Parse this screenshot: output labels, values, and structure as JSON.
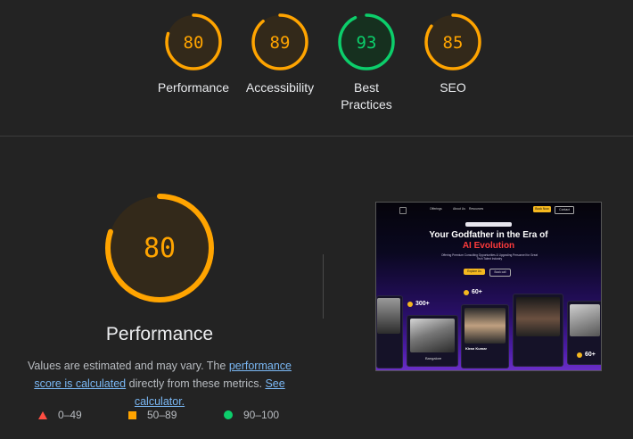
{
  "colors": {
    "orange": "#ffa400",
    "green": "#0cce6b",
    "red": "#ff4e42",
    "link": "#7ab8f5"
  },
  "scores": [
    {
      "label": "Performance",
      "value": 80,
      "rating": "average"
    },
    {
      "label": "Accessibility",
      "value": 89,
      "rating": "average"
    },
    {
      "label": "Best Practices",
      "value": 93,
      "rating": "pass"
    },
    {
      "label": "SEO",
      "value": 85,
      "rating": "average"
    }
  ],
  "main": {
    "title": "Performance",
    "score": 80,
    "note_prefix": "Values are estimated and may vary. The ",
    "note_link1": "performance score is calculated",
    "note_middle": " directly from these metrics. ",
    "note_link2": "See calculator."
  },
  "legend": [
    {
      "shape": "triangle",
      "range": "0–49"
    },
    {
      "shape": "square",
      "range": "50–89"
    },
    {
      "shape": "circle",
      "range": "90–100"
    }
  ],
  "screenshot": {
    "nav_items": [
      "Offerings",
      "About Us",
      "Resources"
    ],
    "nav_primary": "Book Now",
    "nav_secondary": "Contact",
    "headline": "Your Godfather in the Era of",
    "headline_accent": "AI Evolution",
    "subtext": "Offering Premium Consulting Opportunities & Upgrading Personnel for Great Tech Talent Industry",
    "cta_primary": "Explore Us",
    "cta_secondary": "Book call",
    "stat1": "300+",
    "stat2": "60+",
    "stat3": "60+",
    "person_name": "Kiran Kumar",
    "place_label": "Bangalore"
  }
}
